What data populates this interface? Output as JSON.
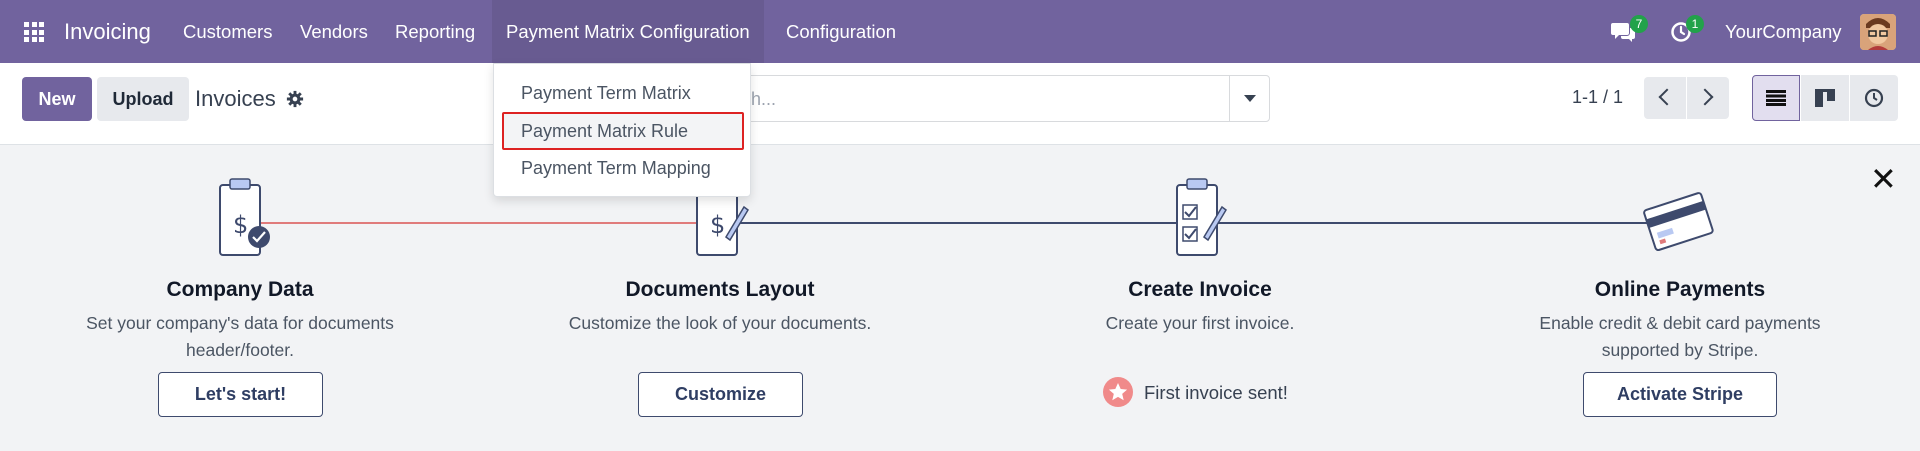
{
  "navbar": {
    "brand": "Invoicing",
    "menu": [
      "Customers",
      "Vendors",
      "Reporting",
      "Payment Matrix Configuration",
      "Configuration"
    ],
    "messages_count": "7",
    "activities_count": "1",
    "company": "YourCompany"
  },
  "control": {
    "new_label": "New",
    "upload_label": "Upload",
    "title": "Invoices",
    "search_placeholder": "h...",
    "pager": "1-1 / 1"
  },
  "dropdown": {
    "items": [
      "Payment Term Matrix",
      "Payment Matrix Rule",
      "Payment Term Mapping"
    ],
    "highlighted_index": 1
  },
  "onboarding": {
    "steps": [
      {
        "title": "Company Data",
        "desc_line1": "Set your company's data for documents",
        "desc_line2": "header/footer.",
        "button": "Let's start!"
      },
      {
        "title": "Documents Layout",
        "desc_line1": "Customize the look of your documents.",
        "desc_line2": "",
        "button": "Customize"
      },
      {
        "title": "Create Invoice",
        "desc_line1": "Create your first invoice.",
        "desc_line2": "",
        "done_text": "First invoice sent!"
      },
      {
        "title": "Online Payments",
        "desc_line1": "Enable credit & debit card payments",
        "desc_line2": "supported by Stripe.",
        "button": "Activate Stripe"
      }
    ]
  },
  "colors": {
    "navbar": "#71639e",
    "primary": "#71639e",
    "done_line": "#e07b7b",
    "todo_line": "#3e4a6d",
    "highlight_border": "#dd2222",
    "badge": "#22a24a"
  }
}
